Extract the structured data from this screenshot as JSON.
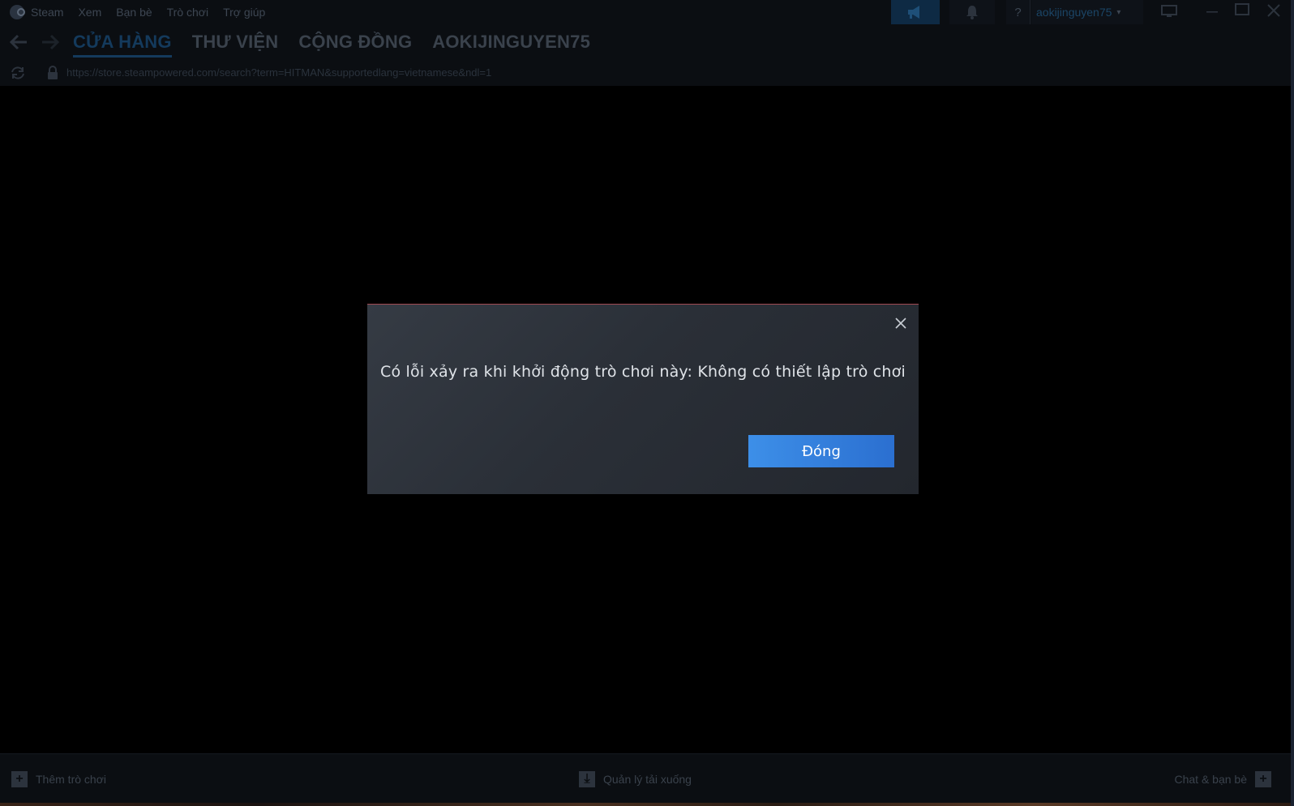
{
  "menu": {
    "items": [
      "Steam",
      "Xem",
      "Bạn bè",
      "Trò chơi",
      "Trợ giúp"
    ]
  },
  "topbar": {
    "help_label": "?",
    "username": "aokijinguyen75"
  },
  "nav": {
    "tabs": [
      "CỬA HÀNG",
      "THƯ VIỆN",
      "CỘNG ĐỒNG",
      "AOKIJINGUYEN75"
    ],
    "active_tab": "CỬA HÀNG"
  },
  "urlbar": {
    "url": "https://store.steampowered.com/search?term=HITMAN&supportedlang=vietnamese&ndl=1"
  },
  "dialog": {
    "message": "Có lỗi xảy ra khi khởi động trò chơi này: Không có thiết lập trò chơi",
    "button_label": "Đóng"
  },
  "bottombar": {
    "add_game_label": "Thêm trò chơi",
    "downloads_label": "Quản lý tải xuống",
    "chat_label": "Chat & bạn bè"
  },
  "colors": {
    "accent": "#3d8fe8",
    "dialog_top_border": "#a14a52",
    "background": "#000000"
  }
}
